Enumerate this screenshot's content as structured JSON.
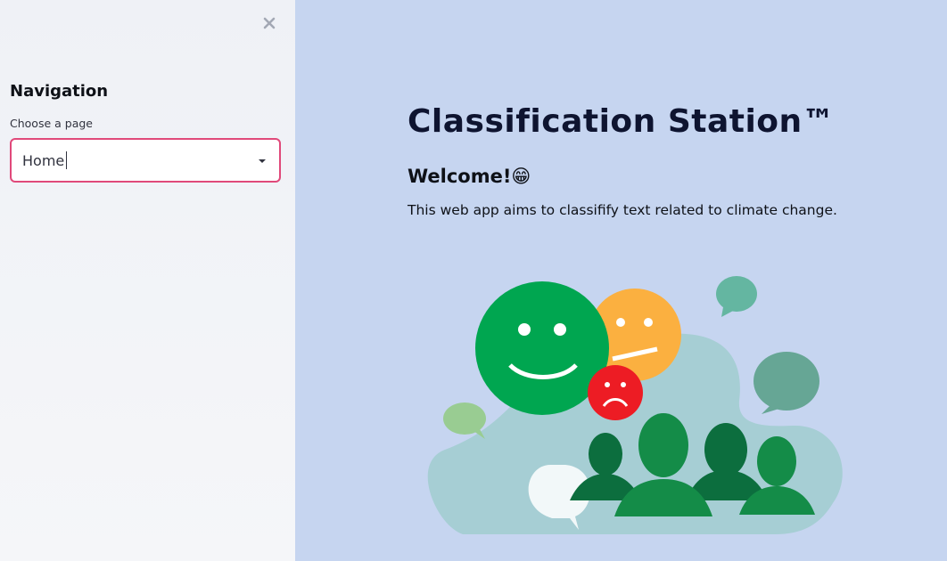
{
  "sidebar": {
    "close_icon": "close-icon",
    "nav_title": "Navigation",
    "select_label": "Choose a page",
    "select_value": "Home",
    "accent_color": "#e0497a"
  },
  "main": {
    "title": "Classification Station™",
    "welcome": "Welcome!😁",
    "description": "This web app aims to classifify text related to climate change.",
    "background_color": "#c6d5f0",
    "hero_image": "emoji-faces-crowd-illustration"
  }
}
